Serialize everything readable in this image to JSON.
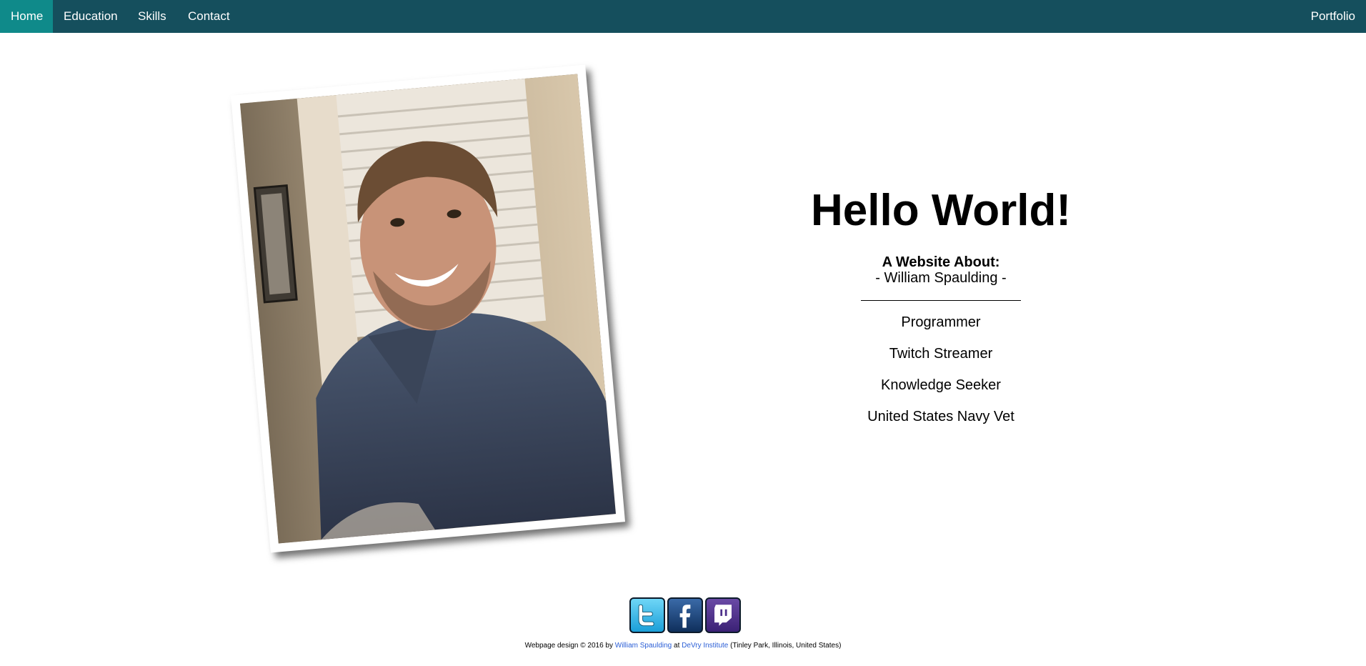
{
  "nav": {
    "items": [
      {
        "label": "Home",
        "active": true
      },
      {
        "label": "Education"
      },
      {
        "label": "Skills"
      },
      {
        "label": "Contact"
      }
    ],
    "right_label": "Portfolio",
    "colors": {
      "bar": "#154f5d",
      "active": "#0f8a8a"
    }
  },
  "hero": {
    "title": "Hello World!",
    "about_label": "A Website About:",
    "name": "- William Spaulding -",
    "roles": [
      "Programmer",
      "Twitch Streamer",
      "Knowledge Seeker",
      "United States Navy Vet"
    ]
  },
  "photo": {
    "subject": "portrait photo of William Spaulding"
  },
  "social": [
    {
      "name": "twitter-icon"
    },
    {
      "name": "facebook-icon"
    },
    {
      "name": "twitch-icon"
    }
  ],
  "footer": {
    "prefix": "Webpage design © 2016 by",
    "author": "William Spaulding",
    "at": "at",
    "school": "DeVry Institute",
    "location": "(Tinley Park, Illinois, United States)"
  }
}
